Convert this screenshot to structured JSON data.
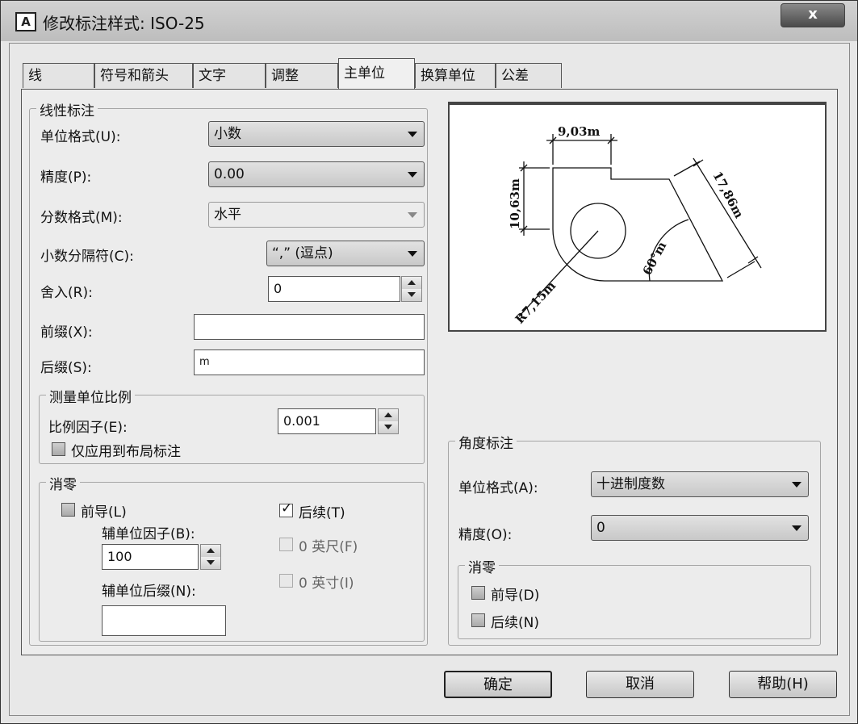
{
  "window": {
    "title": "修改标注样式: ISO-25",
    "icon": "app-icon-A",
    "close_label": "x"
  },
  "tabs": [
    {
      "label": "线",
      "active": false
    },
    {
      "label": "符号和箭头",
      "active": false
    },
    {
      "label": "文字",
      "active": false
    },
    {
      "label": "调整",
      "active": false
    },
    {
      "label": "主单位",
      "active": true
    },
    {
      "label": "换算单位",
      "active": false
    },
    {
      "label": "公差",
      "active": false
    }
  ],
  "linear": {
    "group_title": "线性标注",
    "unit_format_label": "单位格式(U):",
    "unit_format_value": "小数",
    "precision_label": "精度(P):",
    "precision_value": "0.00",
    "fraction_format_label": "分数格式(M):",
    "fraction_format_value": "水平",
    "decimal_sep_label": "小数分隔符(C):",
    "decimal_sep_value": "“,” (逗点)",
    "round_label": "舍入(R):",
    "round_value": "0",
    "prefix_label": "前缀(X):",
    "prefix_value": "",
    "suffix_label": "后缀(S):",
    "suffix_value": "m"
  },
  "scale": {
    "group_title": "测量单位比例",
    "factor_label": "比例因子(E):",
    "factor_value": "0.001",
    "layout_only_label": "仅应用到布局标注",
    "layout_only_checked": false
  },
  "zero": {
    "group_title": "消零",
    "leading_label": "前导(L)",
    "leading_checked": false,
    "sub_factor_label": "辅单位因子(B):",
    "sub_factor_value": "100",
    "sub_suffix_label": "辅单位后缀(N):",
    "sub_suffix_value": "",
    "trailing_label": "后续(T)",
    "trailing_checked": true,
    "feet_label": "0 英尺(F)",
    "feet_checked": false,
    "inches_label": "0 英寸(I)",
    "inches_checked": false
  },
  "preview": {
    "dim_top": "9,03m",
    "dim_left": "10,63m",
    "dim_right": "17,86m",
    "dim_angle": "60°m",
    "dim_radius": "R7,15m"
  },
  "angular": {
    "group_title": "角度标注",
    "unit_format_label": "单位格式(A):",
    "unit_format_value": "十进制度数",
    "precision_label": "精度(O):",
    "precision_value": "0",
    "zero_title": "消零",
    "leading_label": "前导(D)",
    "leading_checked": false,
    "trailing_label": "后续(N)",
    "trailing_checked": false
  },
  "buttons": {
    "ok": "确定",
    "cancel": "取消",
    "help": "帮助(H)"
  }
}
